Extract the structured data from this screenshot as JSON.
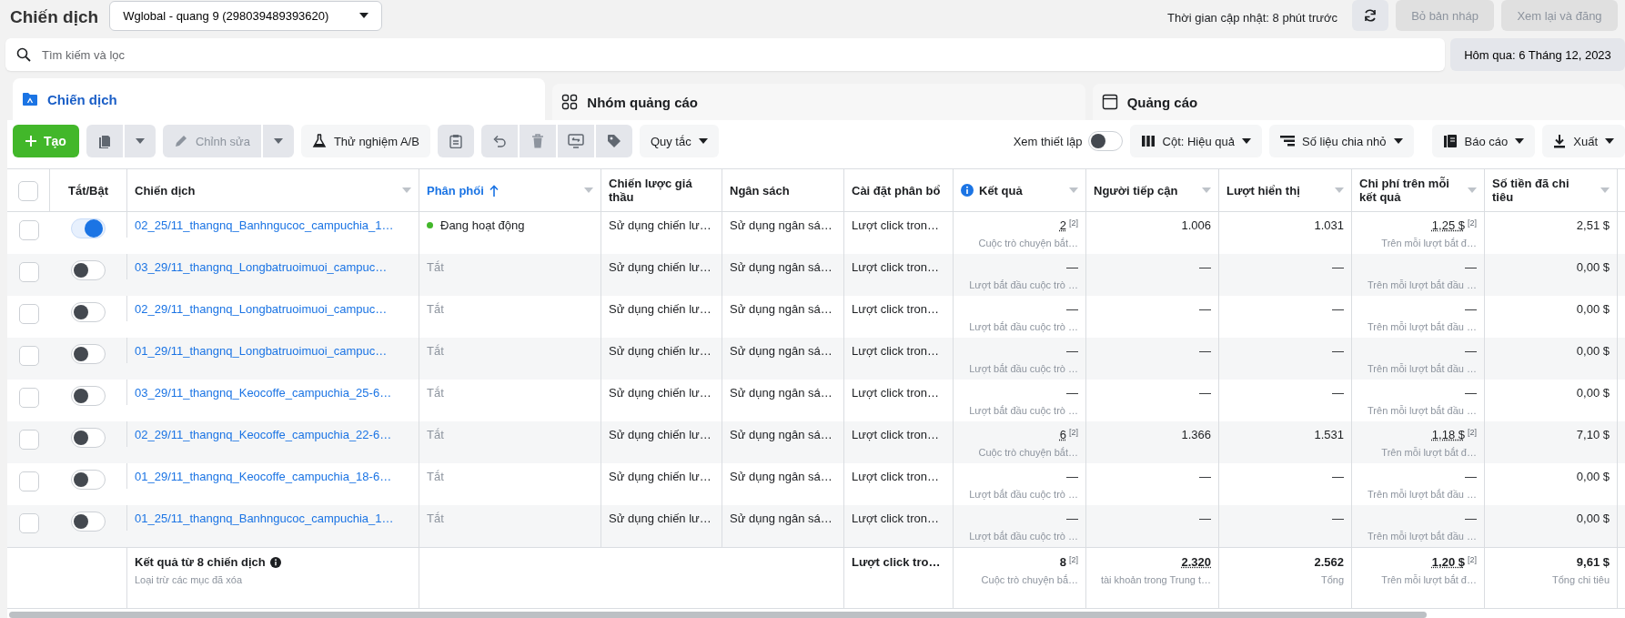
{
  "header": {
    "title": "Chiến dịch",
    "account": "Wglobal - quang 9 (298039489393620)",
    "update_time": "Thời gian cập nhật: 8 phút trước",
    "buttons": [
      {
        "label": "Bỏ bản nháp",
        "disabled": true
      },
      {
        "label": "Xem lại và đăng",
        "disabled": true
      }
    ]
  },
  "search": {
    "placeholder": "Tìm kiếm và lọc"
  },
  "date_range": "Hôm qua: 6 Tháng 12, 2023",
  "tabs": [
    {
      "label": "Chiến dịch",
      "kind": "campaign",
      "selected": true
    },
    {
      "label": "Nhóm quảng cáo",
      "kind": "adset",
      "selected": false
    },
    {
      "label": "Quảng cáo",
      "kind": "ad",
      "selected": false
    }
  ],
  "toolbar": {
    "create": {
      "label": "Tạo"
    },
    "edit": {
      "label": "Chỉnh sửa",
      "disabled": true
    },
    "ab_test": {
      "label": "Thử nghiệm A/B"
    },
    "rules": {
      "label": "Quy tắc"
    },
    "view_setup": {
      "label": "Xem thiết lập",
      "on": false
    },
    "columns": {
      "label": "Cột: Hiệu quả"
    },
    "breakdown": {
      "label": "Số liệu chia nhỏ"
    },
    "reports": {
      "label": "Báo cáo"
    },
    "export": {
      "label": "Xuất"
    }
  },
  "table": {
    "select_all": {
      "checked": false
    },
    "columns": [
      {
        "label": "Tắt/Bật"
      },
      {
        "label": "Chiến dịch",
        "menu": true
      },
      {
        "label": "Phân phối",
        "menu": true,
        "sorted": true
      },
      {
        "label": "Chiến lược giá thầu"
      },
      {
        "label": "Ngân sách"
      },
      {
        "label": "Cài đặt phân bổ"
      },
      {
        "label": "Kết quả",
        "menu": true,
        "info": true
      },
      {
        "label": "Người tiếp cận",
        "menu": true
      },
      {
        "label": "Lượt hiển thị",
        "menu": true
      },
      {
        "label": "Chi phí trên mỗi kết quả",
        "menu": true
      },
      {
        "label": "Số tiền đã chi tiêu",
        "menu": true
      }
    ],
    "rows": [
      {
        "checked": false,
        "on": true,
        "name": "02_25/11_thangnq_Banhngucoc_campuchia_1…",
        "delivery": "Đang hoạt động",
        "active": true,
        "bid": "Sử dụng chiến lư…",
        "budget": "Sử dụng ngân sá…",
        "attribution": "Lượt click tron…",
        "result": "2",
        "result_note": "[2]",
        "result_sub": "Cuộc trò chuyện bắt…",
        "reach": "1.006",
        "impressions": "1.031",
        "cost": "1,25 $",
        "cost_note": "[2]",
        "cost_sub": "Trên mỗi lượt bắt đ…",
        "spent": "2,51 $"
      },
      {
        "checked": false,
        "on": false,
        "name": "03_29/11_thangnq_Longbatruoimuoi_campuc…",
        "delivery": "Tắt",
        "active": false,
        "bid": "Sử dụng chiến lư…",
        "budget": "Sử dụng ngân sá…",
        "attribution": "Lượt click tron…",
        "result": "—",
        "result_sub": "Lượt bắt đầu cuộc trò …",
        "reach": "—",
        "impressions": "—",
        "cost": "—",
        "cost_sub": "Trên mỗi lượt bắt đầu …",
        "spent": "0,00 $"
      },
      {
        "checked": false,
        "on": false,
        "name": "02_29/11_thangnq_Longbatruoimuoi_campuc…",
        "delivery": "Tắt",
        "active": false,
        "bid": "Sử dụng chiến lư…",
        "budget": "Sử dụng ngân sá…",
        "attribution": "Lượt click tron…",
        "result": "—",
        "result_sub": "Lượt bắt đầu cuộc trò …",
        "reach": "—",
        "impressions": "—",
        "cost": "—",
        "cost_sub": "Trên mỗi lượt bắt đầu …",
        "spent": "0,00 $"
      },
      {
        "checked": false,
        "on": false,
        "name": "01_29/11_thangnq_Longbatruoimuoi_campuc…",
        "delivery": "Tắt",
        "active": false,
        "bid": "Sử dụng chiến lư…",
        "budget": "Sử dụng ngân sá…",
        "attribution": "Lượt click tron…",
        "result": "—",
        "result_sub": "Lượt bắt đầu cuộc trò …",
        "reach": "—",
        "impressions": "—",
        "cost": "—",
        "cost_sub": "Trên mỗi lượt bắt đầu …",
        "spent": "0,00 $"
      },
      {
        "checked": false,
        "on": false,
        "name": "03_29/11_thangnq_Keocoffe_campuchia_25-6…",
        "delivery": "Tắt",
        "active": false,
        "bid": "Sử dụng chiến lư…",
        "budget": "Sử dụng ngân sá…",
        "attribution": "Lượt click tron…",
        "result": "—",
        "result_sub": "Lượt bắt đầu cuộc trò …",
        "reach": "—",
        "impressions": "—",
        "cost": "—",
        "cost_sub": "Trên mỗi lượt bắt đầu …",
        "spent": "0,00 $"
      },
      {
        "checked": false,
        "on": false,
        "name": "02_29/11_thangnq_Keocoffe_campuchia_22-6…",
        "delivery": "Tắt",
        "active": false,
        "bid": "Sử dụng chiến lư…",
        "budget": "Sử dụng ngân sá…",
        "attribution": "Lượt click tron…",
        "result": "6",
        "result_note": "[2]",
        "result_sub": "Cuộc trò chuyện bắt…",
        "reach": "1.366",
        "impressions": "1.531",
        "cost": "1,18 $",
        "cost_note": "[2]",
        "cost_sub": "Trên mỗi lượt bắt đ…",
        "spent": "7,10 $"
      },
      {
        "checked": false,
        "on": false,
        "name": "01_29/11_thangnq_Keocoffe_campuchia_18-6…",
        "delivery": "Tắt",
        "active": false,
        "bid": "Sử dụng chiến lư…",
        "budget": "Sử dụng ngân sá…",
        "attribution": "Lượt click tron…",
        "result": "—",
        "result_sub": "Lượt bắt đầu cuộc trò …",
        "reach": "—",
        "impressions": "—",
        "cost": "—",
        "cost_sub": "Trên mỗi lượt bắt đầu …",
        "spent": "0,00 $"
      },
      {
        "checked": false,
        "on": false,
        "name": "01_25/11_thangnq_Banhngucoc_campuchia_1…",
        "delivery": "Tắt",
        "active": false,
        "bid": "Sử dụng chiến lư…",
        "budget": "Sử dụng ngân sá…",
        "attribution": "Lượt click tron…",
        "result": "—",
        "result_sub": "Lượt bắt đầu cuộc trò …",
        "reach": "—",
        "impressions": "—",
        "cost": "—",
        "cost_sub": "Trên mỗi lượt bắt đầu …",
        "spent": "0,00 $"
      }
    ],
    "summary": {
      "label": "Kết quả từ 8 chiến dịch",
      "sub": "Loại trừ các mục đã xóa",
      "attribution": "Lượt click tro…",
      "result": "8",
      "result_note": "[2]",
      "result_sub": "Cuộc trò chuyện bắ…",
      "reach": "2.320",
      "reach_sub": "tài khoản trong Trung t…",
      "impressions": "2.562",
      "impressions_sub": "Tổng",
      "cost": "1,20 $",
      "cost_note": "[2]",
      "cost_sub": "Trên mỗi lượt bắt đ…",
      "spent": "9,61 $",
      "spent_sub": "Tổng chi tiêu"
    }
  }
}
